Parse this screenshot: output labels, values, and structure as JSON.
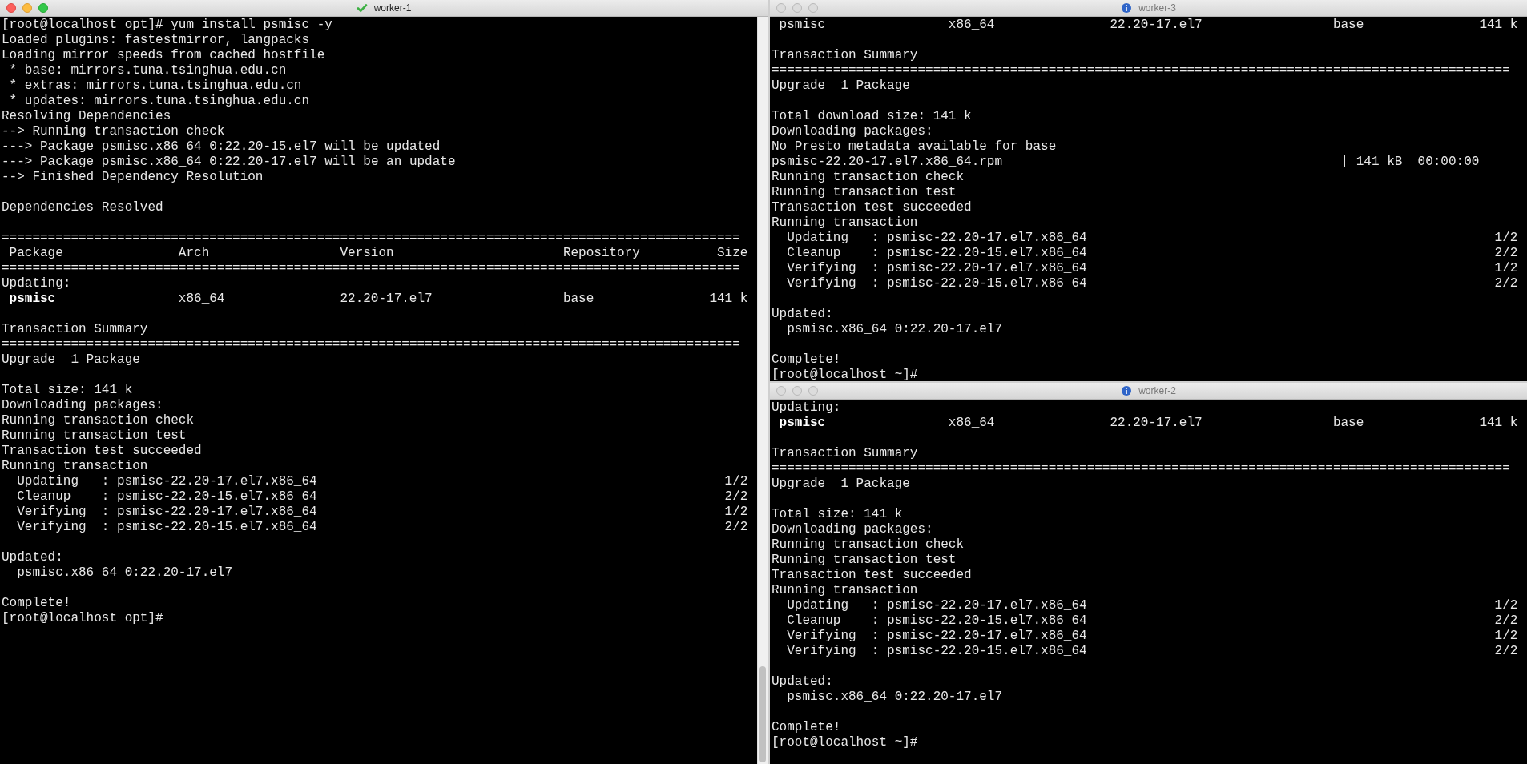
{
  "windows": [
    {
      "title": "worker-1",
      "active": true,
      "kind": "check",
      "lines": [
        {
          "kind": "text",
          "text": "[root@localhost opt]# yum install psmisc -y"
        },
        {
          "kind": "text",
          "text": "Loaded plugins: fastestmirror, langpacks"
        },
        {
          "kind": "text",
          "text": "Loading mirror speeds from cached hostfile"
        },
        {
          "kind": "text",
          "text": " * base: mirrors.tuna.tsinghua.edu.cn"
        },
        {
          "kind": "text",
          "text": " * extras: mirrors.tuna.tsinghua.edu.cn"
        },
        {
          "kind": "text",
          "text": " * updates: mirrors.tuna.tsinghua.edu.cn"
        },
        {
          "kind": "text",
          "text": "Resolving Dependencies"
        },
        {
          "kind": "text",
          "text": "--> Running transaction check"
        },
        {
          "kind": "text",
          "text": "---> Package psmisc.x86_64 0:22.20-15.el7 will be updated"
        },
        {
          "kind": "text",
          "text": "---> Package psmisc.x86_64 0:22.20-17.el7 will be an update"
        },
        {
          "kind": "text",
          "text": "--> Finished Dependency Resolution"
        },
        {
          "kind": "blank"
        },
        {
          "kind": "text",
          "text": "Dependencies Resolved"
        },
        {
          "kind": "blank"
        },
        {
          "kind": "rule",
          "text": "================================================================================================"
        },
        {
          "kind": "header",
          "cells": [
            "Package",
            "Arch",
            "Version",
            "Repository",
            "Size"
          ]
        },
        {
          "kind": "rule",
          "text": "================================================================================================"
        },
        {
          "kind": "text",
          "text": "Updating:"
        },
        {
          "kind": "row",
          "emphasized": true,
          "cells": [
            "psmisc",
            "x86_64",
            "22.20-17.el7",
            "base",
            "141 k"
          ]
        },
        {
          "kind": "blank"
        },
        {
          "kind": "text",
          "text": "Transaction Summary"
        },
        {
          "kind": "rule",
          "text": "================================================================================================"
        },
        {
          "kind": "text",
          "text": "Upgrade  1 Package"
        },
        {
          "kind": "blank"
        },
        {
          "kind": "text",
          "text": "Total size: 141 k"
        },
        {
          "kind": "text",
          "text": "Downloading packages:"
        },
        {
          "kind": "text",
          "text": "Running transaction check"
        },
        {
          "kind": "text",
          "text": "Running transaction test"
        },
        {
          "kind": "text",
          "text": "Transaction test succeeded"
        },
        {
          "kind": "text",
          "text": "Running transaction"
        },
        {
          "kind": "step",
          "text": "  Updating   : psmisc-22.20-17.el7.x86_64",
          "count": "1/2"
        },
        {
          "kind": "step",
          "text": "  Cleanup    : psmisc-22.20-15.el7.x86_64",
          "count": "2/2"
        },
        {
          "kind": "step",
          "text": "  Verifying  : psmisc-22.20-17.el7.x86_64",
          "count": "1/2"
        },
        {
          "kind": "step",
          "text": "  Verifying  : psmisc-22.20-15.el7.x86_64",
          "count": "2/2"
        },
        {
          "kind": "blank"
        },
        {
          "kind": "text",
          "text": "Updated:"
        },
        {
          "kind": "text",
          "text": "  psmisc.x86_64 0:22.20-17.el7"
        },
        {
          "kind": "blank"
        },
        {
          "kind": "text",
          "text": "Complete!"
        },
        {
          "kind": "text",
          "text": "[root@localhost opt]#"
        }
      ]
    },
    {
      "title": "worker-3",
      "active": false,
      "kind": "info",
      "lines": [
        {
          "kind": "row",
          "emphasized": false,
          "cells": [
            "psmisc",
            "x86_64",
            "22.20-17.el7",
            "base",
            "141 k"
          ]
        },
        {
          "kind": "blank"
        },
        {
          "kind": "text",
          "text": "Transaction Summary"
        },
        {
          "kind": "rule",
          "text": "================================================================================================"
        },
        {
          "kind": "text",
          "text": "Upgrade  1 Package"
        },
        {
          "kind": "blank"
        },
        {
          "kind": "text",
          "text": "Total download size: 141 k"
        },
        {
          "kind": "text",
          "text": "Downloading packages:"
        },
        {
          "kind": "text",
          "text": "No Presto metadata available for base"
        },
        {
          "kind": "download",
          "text": "psmisc-22.20-17.el7.x86_64.rpm",
          "info": "| 141 kB  00:00:00"
        },
        {
          "kind": "text",
          "text": "Running transaction check"
        },
        {
          "kind": "text",
          "text": "Running transaction test"
        },
        {
          "kind": "text",
          "text": "Transaction test succeeded"
        },
        {
          "kind": "text",
          "text": "Running transaction"
        },
        {
          "kind": "step",
          "text": "  Updating   : psmisc-22.20-17.el7.x86_64",
          "count": "1/2"
        },
        {
          "kind": "step",
          "text": "  Cleanup    : psmisc-22.20-15.el7.x86_64",
          "count": "2/2"
        },
        {
          "kind": "step",
          "text": "  Verifying  : psmisc-22.20-17.el7.x86_64",
          "count": "1/2"
        },
        {
          "kind": "step",
          "text": "  Verifying  : psmisc-22.20-15.el7.x86_64",
          "count": "2/2"
        },
        {
          "kind": "blank"
        },
        {
          "kind": "text",
          "text": "Updated:"
        },
        {
          "kind": "text",
          "text": "  psmisc.x86_64 0:22.20-17.el7"
        },
        {
          "kind": "blank"
        },
        {
          "kind": "text",
          "text": "Complete!"
        },
        {
          "kind": "text",
          "text": "[root@localhost ~]#"
        }
      ]
    },
    {
      "title": "worker-2",
      "active": false,
      "kind": "info",
      "lines": [
        {
          "kind": "text",
          "text": "Updating:"
        },
        {
          "kind": "row",
          "emphasized": true,
          "cells": [
            "psmisc",
            "x86_64",
            "22.20-17.el7",
            "base",
            "141 k"
          ]
        },
        {
          "kind": "blank"
        },
        {
          "kind": "text",
          "text": "Transaction Summary"
        },
        {
          "kind": "rule",
          "text": "================================================================================================"
        },
        {
          "kind": "text",
          "text": "Upgrade  1 Package"
        },
        {
          "kind": "blank"
        },
        {
          "kind": "text",
          "text": "Total size: 141 k"
        },
        {
          "kind": "text",
          "text": "Downloading packages:"
        },
        {
          "kind": "text",
          "text": "Running transaction check"
        },
        {
          "kind": "text",
          "text": "Running transaction test"
        },
        {
          "kind": "text",
          "text": "Transaction test succeeded"
        },
        {
          "kind": "text",
          "text": "Running transaction"
        },
        {
          "kind": "step",
          "text": "  Updating   : psmisc-22.20-17.el7.x86_64",
          "count": "1/2"
        },
        {
          "kind": "step",
          "text": "  Cleanup    : psmisc-22.20-15.el7.x86_64",
          "count": "2/2"
        },
        {
          "kind": "step",
          "text": "  Verifying  : psmisc-22.20-17.el7.x86_64",
          "count": "1/2"
        },
        {
          "kind": "step",
          "text": "  Verifying  : psmisc-22.20-15.el7.x86_64",
          "count": "2/2"
        },
        {
          "kind": "blank"
        },
        {
          "kind": "text",
          "text": "Updated:"
        },
        {
          "kind": "text",
          "text": "  psmisc.x86_64 0:22.20-17.el7"
        },
        {
          "kind": "blank"
        },
        {
          "kind": "text",
          "text": "Complete!"
        },
        {
          "kind": "text",
          "text": "[root@localhost ~]#"
        }
      ]
    }
  ]
}
